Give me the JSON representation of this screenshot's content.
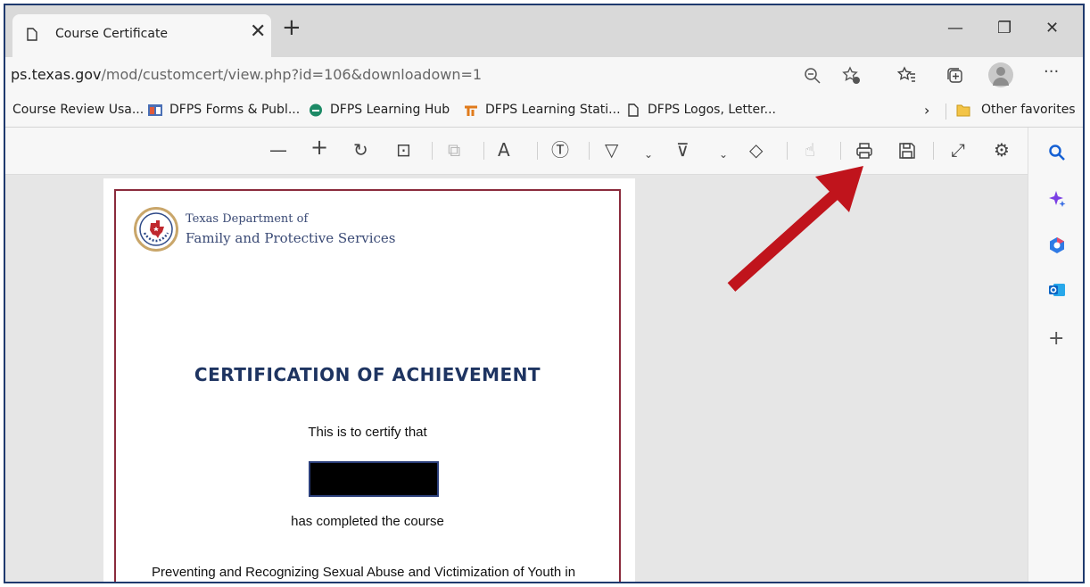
{
  "tab": {
    "title": "Course Certificate",
    "close": "✕",
    "new": "+"
  },
  "window": {
    "minimize": "—",
    "restore": "❐",
    "close": "✕"
  },
  "address": {
    "url_host": "ps.texas.gov",
    "url_rest": "/mod/customcert/view.php?id=106&downloadown=1"
  },
  "favorites": {
    "items": [
      {
        "label": "Course Review Usa..."
      },
      {
        "label": "DFPS Forms & Publ..."
      },
      {
        "label": "DFPS Learning Hub"
      },
      {
        "label": "DFPS Learning Stati..."
      },
      {
        "label": "DFPS Logos, Letter..."
      }
    ],
    "other": "Other favorites"
  },
  "toolbar": {
    "zoom_out": "—",
    "zoom_in": "+",
    "rotate": "↻",
    "fit": "⊡",
    "pages": "⧉",
    "read_aloud": "A",
    "text": "Ⓣ",
    "draw": "▽",
    "highlight": "⊽",
    "erase": "◇",
    "touch": "☝",
    "print": "⎙",
    "save": "🖫",
    "fullscreen": "⤢",
    "settings": "⚙"
  },
  "sidebar": {
    "search": "🔍",
    "copilot": "✦",
    "office": "⬡",
    "outlook": "O",
    "add": "+"
  },
  "certificate": {
    "org_line1": "Texas Department of",
    "org_line2": "Family and Protective Services",
    "seal_text": "DFPS",
    "title": "CERTIFICATION OF ACHIEVEMENT",
    "certify": "This is to certify that",
    "completed": "has completed the course",
    "course_name": "Preventing and Recognizing Sexual Abuse and Victimization of Youth in Foster Care"
  },
  "colors": {
    "arrow": "#c0141c",
    "frame": "#1f3a6e",
    "cert_border": "#8a2b3c",
    "title": "#1e3461"
  }
}
